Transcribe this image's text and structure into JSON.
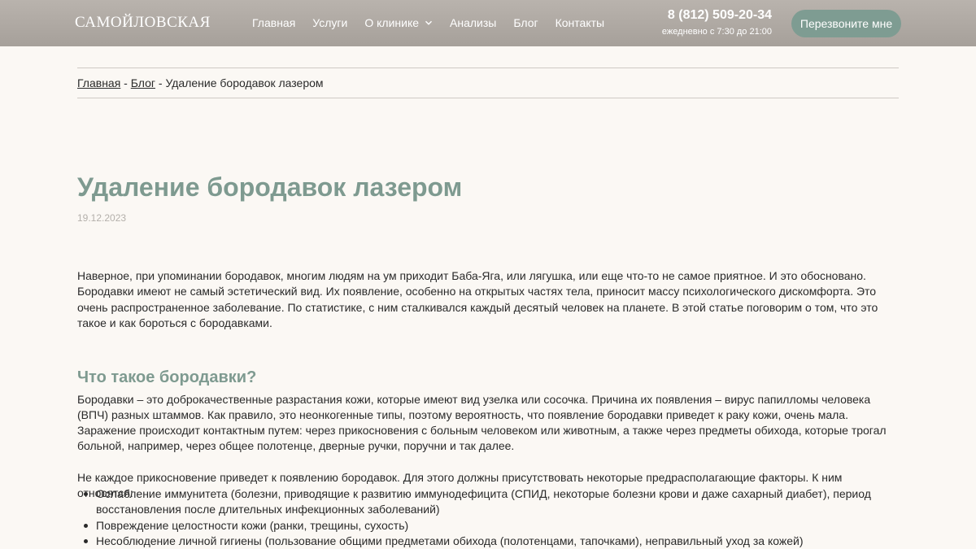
{
  "header": {
    "logo": "САМОЙЛОВСКАЯ",
    "nav": [
      {
        "label": "Главная"
      },
      {
        "label": "Услуги"
      },
      {
        "label": "О клинике"
      },
      {
        "label": "Анализы"
      },
      {
        "label": "Блог"
      },
      {
        "label": "Контакты"
      }
    ],
    "phone": "8 (812) 509-20-34",
    "hours": "ежедневно с 7:30 до 21:00",
    "callback_label": "Перезвоните мне"
  },
  "breadcrumb": {
    "home": "Главная",
    "sep1": " - ",
    "blog": "Блог",
    "sep2": " - ",
    "current": "Удаление бородавок лазером"
  },
  "article": {
    "title": "Удаление бородавок лазером",
    "date": "19.12.2023",
    "intro": "Наверное, при упоминании бородавок, многим людям на ум приходит Баба-Яга, или лягушка, или еще что-то не самое приятное. И это обосновано. Бородавки имеют не самый эстетический вид. Их появление, особенно на открытых частях тела, приносит массу психологического дискомфорта. Это очень распространенное заболевание. По статистике, с ним сталкивался каждый десятый человек на планете. В этой статье поговорим о том, что это такое и как бороться с бородавками.",
    "section_title": "Что такое бородавки?",
    "section_p1": "Бородавки – это доброкачественные разрастания кожи, которые имеют вид узелка или сосочка. Причина их появления – вирус папилломы человека (ВПЧ) разных штаммов. Как правило, это неонкогенные типы, поэтому вероятность, что появление бородавки приведет к раку кожи, очень мала.",
    "section_p2": "Заражение происходит контактным путем: через прикосновения с больным человеком или животным, а также через предметы обихода, которые трогал больной, например, через общее полотенце, дверные ручки, поручни и так далее.",
    "factors_intro": "Не каждое прикосновение приведет к появлению бородавок. Для этого должны присутствовать некоторые предрасполагающие факторы. К ним относятся:",
    "factors": [
      "Ослабление иммунитета (болезни, приводящие к развитию иммунодефицита (СПИД, некоторые болезни крови и даже сахарный диабет), период восстановления после длительных инфекционных заболеваний)",
      "Повреждение целостности кожи (ранки, трещины, сухость)",
      "Несоблюдение личной гигиены (пользование общими предметами обихода (полотенцами, тапочками), неправильный уход за кожей)"
    ]
  }
}
